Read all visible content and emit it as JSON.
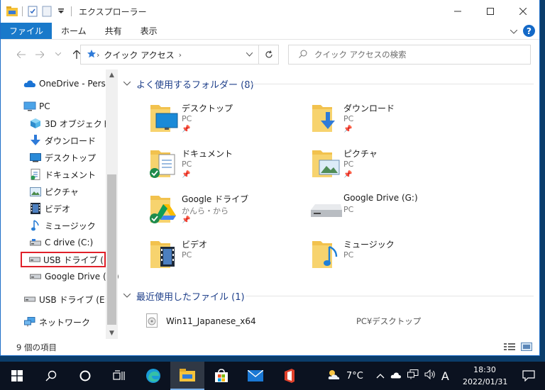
{
  "window": {
    "title": "エクスプローラー"
  },
  "ribbon": {
    "tabs": [
      "ファイル",
      "ホーム",
      "共有",
      "表示"
    ]
  },
  "address": {
    "crumb": "クイック アクセス"
  },
  "search": {
    "placeholder": "クイック アクセスの検索"
  },
  "sidebar": {
    "items": [
      {
        "label": "OneDrive - Personal",
        "icon": "onedrive-icon"
      },
      {
        "label": "PC",
        "icon": "pc-icon"
      },
      {
        "label": "3D オブジェクト",
        "icon": "3d-objects-icon"
      },
      {
        "label": "ダウンロード",
        "icon": "download-icon"
      },
      {
        "label": "デスクトップ",
        "icon": "desktop-icon"
      },
      {
        "label": "ドキュメント",
        "icon": "documents-icon"
      },
      {
        "label": "ピクチャ",
        "icon": "pictures-icon"
      },
      {
        "label": "ビデオ",
        "icon": "videos-icon"
      },
      {
        "label": "ミュージック",
        "icon": "music-icon"
      },
      {
        "label": "C drive (C:)",
        "icon": "drive-icon"
      },
      {
        "label": "USB ドライブ (E:)",
        "icon": "usb-drive-icon"
      },
      {
        "label": "Google Drive (G:)",
        "icon": "drive-icon"
      },
      {
        "label": "USB ドライブ (E:)",
        "icon": "usb-drive-icon"
      },
      {
        "label": "ネットワーク",
        "icon": "network-icon"
      }
    ]
  },
  "groups": {
    "frequent": {
      "title": "よく使用するフォルダー (8)"
    },
    "recent": {
      "title": "最近使用したファイル (1)"
    }
  },
  "folders": [
    {
      "name": "デスクトップ",
      "sub": "PC",
      "icon": "desktop-folder-icon"
    },
    {
      "name": "ダウンロード",
      "sub": "PC",
      "icon": "download-folder-icon"
    },
    {
      "name": "ドキュメント",
      "sub": "PC",
      "icon": "documents-folder-icon"
    },
    {
      "name": "ピクチャ",
      "sub": "PC",
      "icon": "pictures-folder-icon"
    },
    {
      "name": "Google ドライブ",
      "sub": "かんら・から",
      "icon": "google-drive-folder-icon"
    },
    {
      "name": "Google Drive (G:)",
      "sub": "PC",
      "icon": "google-drive-disk-icon"
    },
    {
      "name": "ビデオ",
      "sub": "PC",
      "icon": "videos-folder-icon"
    },
    {
      "name": "ミュージック",
      "sub": "PC",
      "icon": "music-folder-icon"
    }
  ],
  "recent_files": [
    {
      "name": "Win11_Japanese_x64",
      "location": "PC¥デスクトップ"
    }
  ],
  "status": {
    "count": "9 個の項目"
  },
  "taskbar": {
    "weather": "7°C",
    "ime": "A",
    "time": "18:30",
    "date": "2022/01/31"
  }
}
